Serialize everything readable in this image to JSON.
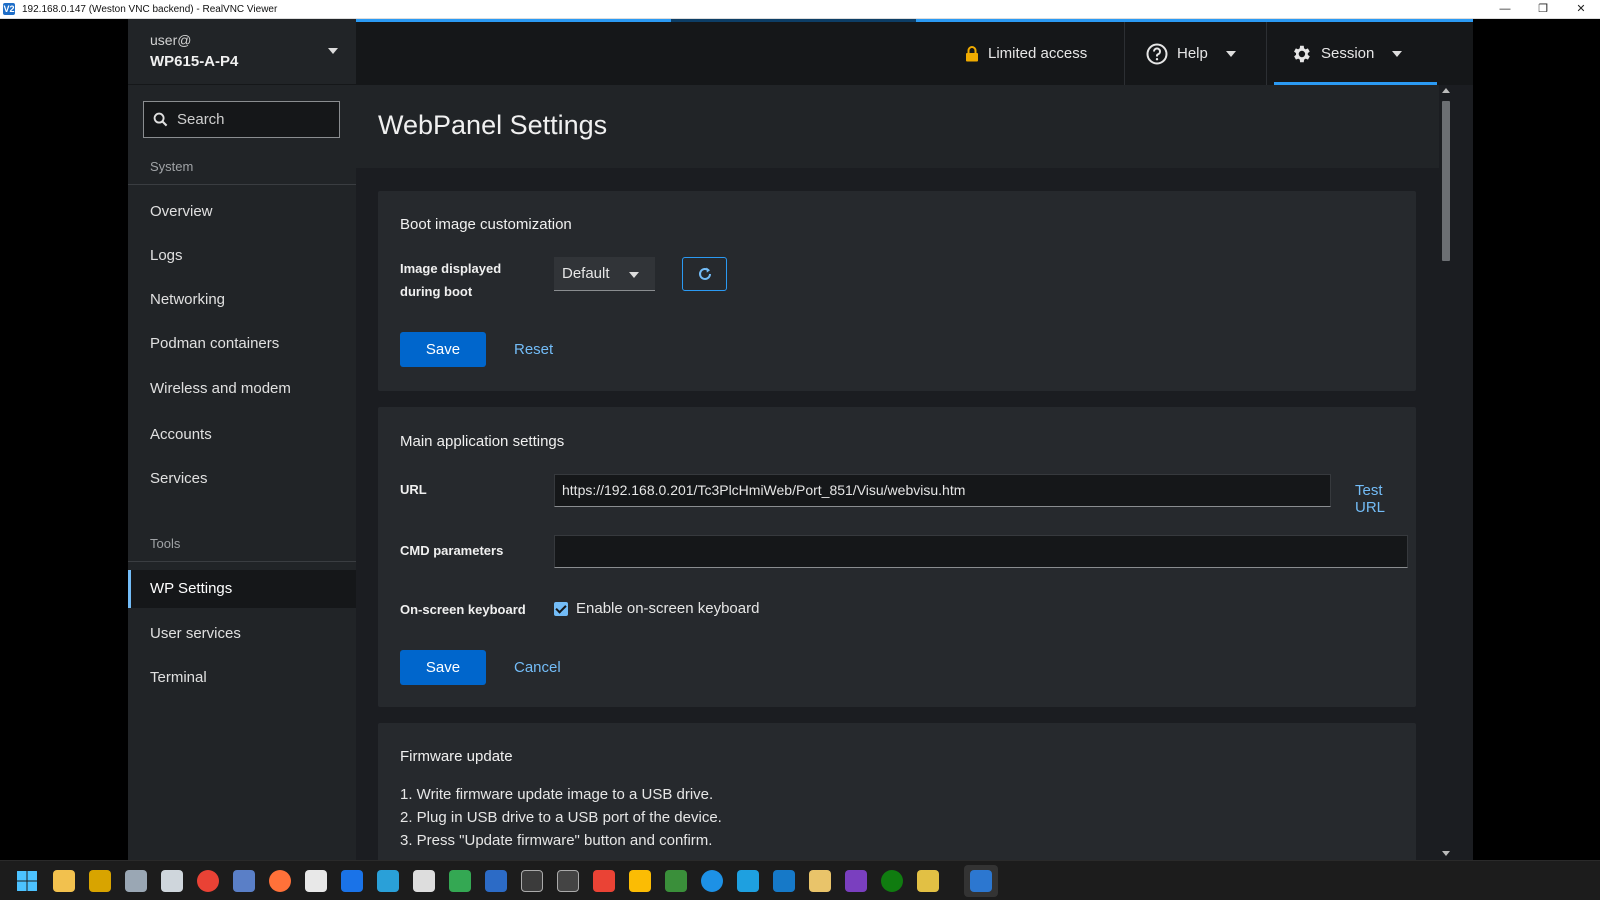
{
  "window": {
    "title": "192.168.0.147 (Weston VNC backend) - RealVNC Viewer",
    "app_icon": "V2"
  },
  "sidebar": {
    "user": "user@",
    "host": "WP615-A-P4",
    "search_placeholder": "Search",
    "system_label": "System",
    "system_items": [
      {
        "label": "Overview"
      },
      {
        "label": "Logs"
      },
      {
        "label": "Networking"
      },
      {
        "label": "Podman containers"
      },
      {
        "label": "Wireless and modem"
      },
      {
        "label": "Accounts"
      },
      {
        "label": "Services"
      }
    ],
    "tools_label": "Tools",
    "tools_items": [
      {
        "label": "WP Settings",
        "active": true
      },
      {
        "label": "User services"
      },
      {
        "label": "Terminal"
      }
    ]
  },
  "masthead": {
    "limited_access": "Limited access",
    "help": "Help",
    "session": "Session"
  },
  "page": {
    "title": "WebPanel Settings"
  },
  "boot_card": {
    "title": "Boot image customization",
    "image_label_line1": "Image displayed",
    "image_label_line2": "during boot",
    "image_value": "Default",
    "save": "Save",
    "reset": "Reset"
  },
  "main_card": {
    "title": "Main application settings",
    "url_label": "URL",
    "url_value": "https://192.168.0.201/Tc3PlcHmiWeb/Port_851/Visu/webvisu.htm",
    "test_url": "Test URL",
    "cmd_label": "CMD parameters",
    "cmd_value": "",
    "keyboard_label": "On-screen keyboard",
    "keyboard_checkbox": "Enable on-screen keyboard",
    "keyboard_checked": true,
    "save": "Save",
    "cancel": "Cancel"
  },
  "firmware_card": {
    "title": "Firmware update",
    "steps": [
      "1. Write firmware update image to a USB drive.",
      "2. Plug in USB drive to a USB port of the device.",
      "3. Press \"Update firmware\" button and confirm."
    ]
  },
  "colors": {
    "accent": "#2b9af3",
    "primary_button": "#0066cc",
    "link": "#73bcf7"
  },
  "taskbar": {
    "icons": [
      "windows-start-icon",
      "file-explorer-icon",
      "network-tool-icon",
      "remote-tool-icon",
      "virtualbox-icon",
      "chrome-icon",
      "app-icon",
      "firefox-icon",
      "storage-icon",
      "calendar-icon",
      "screenshot-icon",
      "media-icon",
      "drive-icon",
      "powershell-icon",
      "cmd-icon",
      "terminal-icon",
      "gmail-icon",
      "google-drive-icon",
      "ram-tool-icon",
      "docker-icon",
      "sync-icon",
      "wireshark-icon",
      "archive-icon",
      "camera-icon",
      "xbox-icon",
      "notes-icon",
      "realvnc-icon"
    ]
  }
}
